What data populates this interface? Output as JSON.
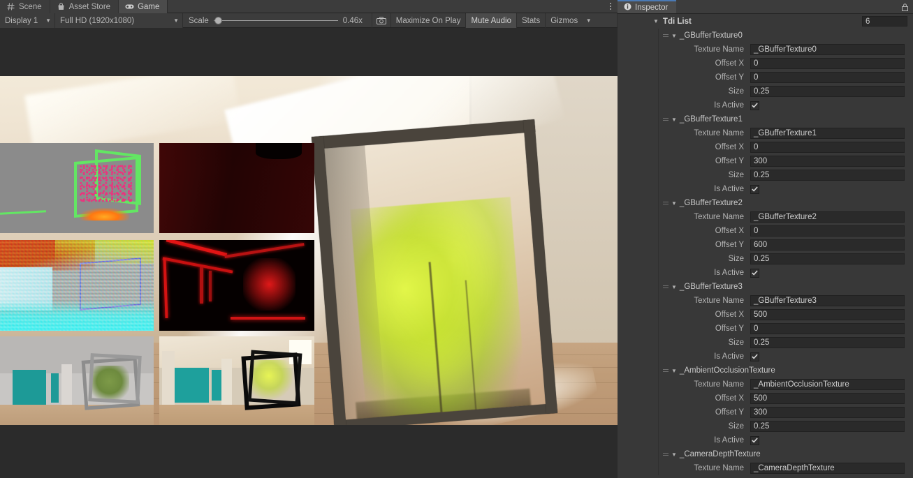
{
  "window": {
    "game_panel": {
      "tabs": [
        {
          "label": "Scene",
          "icon": "grid-icon",
          "active": false
        },
        {
          "label": "Asset Store",
          "icon": "shop-bag-icon",
          "active": false
        },
        {
          "label": "Game",
          "icon": "gamepad-icon",
          "active": true
        }
      ],
      "overflow_menu": "kebab-menu-icon",
      "toolbar": {
        "display": "Display 1",
        "resolution": "Full HD (1920x1080)",
        "scale_label": "Scale",
        "scale_value": "0.46x",
        "screenshot_icon": "camera-icon",
        "maximize_on_play": "Maximize On Play",
        "mute_audio": "Mute Audio",
        "stats": "Stats",
        "gizmos": "Gizmos",
        "gizmos_dropdown": "chevron-down-icon"
      },
      "render_description": "Lit interior architectural scene with skylight, teal accent wall, wooden floor and a tree inside a dark rectangular frame, overlaid with a 2x3 grid of G-buffer debug texture previews."
    }
  },
  "inspector": {
    "tab_label": "Inspector",
    "tab_icon": "info-circle-icon",
    "lock_icon": "lock-icon",
    "list": {
      "title": "Tdi List",
      "foldout": "▼",
      "size": "6"
    },
    "labels": {
      "texture_name": "Texture Name",
      "offset_x": "Offset X",
      "offset_y": "Offset Y",
      "size": "Size",
      "is_active": "Is Active"
    },
    "elements": [
      {
        "header": "_GBufferTexture0",
        "texture_name": "_GBufferTexture0",
        "offset_x": "0",
        "offset_y": "0",
        "size": "0.25",
        "is_active": true
      },
      {
        "header": "_GBufferTexture1",
        "texture_name": "_GBufferTexture1",
        "offset_x": "0",
        "offset_y": "300",
        "size": "0.25",
        "is_active": true
      },
      {
        "header": "_GBufferTexture2",
        "texture_name": "_GBufferTexture2",
        "offset_x": "0",
        "offset_y": "600",
        "size": "0.25",
        "is_active": true
      },
      {
        "header": "_GBufferTexture3",
        "texture_name": "_GBufferTexture3",
        "offset_x": "500",
        "offset_y": "0",
        "size": "0.25",
        "is_active": true
      },
      {
        "header": "_AmbientOcclusionTexture",
        "texture_name": "_AmbientOcclusionTexture",
        "offset_x": "500",
        "offset_y": "300",
        "size": "0.25",
        "is_active": true
      },
      {
        "header": "_CameraDepthTexture",
        "texture_name": "_CameraDepthTexture",
        "offset_x": "",
        "offset_y": "",
        "size": "",
        "is_active": null
      }
    ]
  },
  "colors": {
    "panel_bg": "#383838",
    "toolbar_bg": "#3c3c3c",
    "tab_active_bg": "#4b4b4b",
    "field_bg": "#2a2a2a",
    "text": "#b4b4b4",
    "accent_tab_underline": "#4a7ab5"
  }
}
